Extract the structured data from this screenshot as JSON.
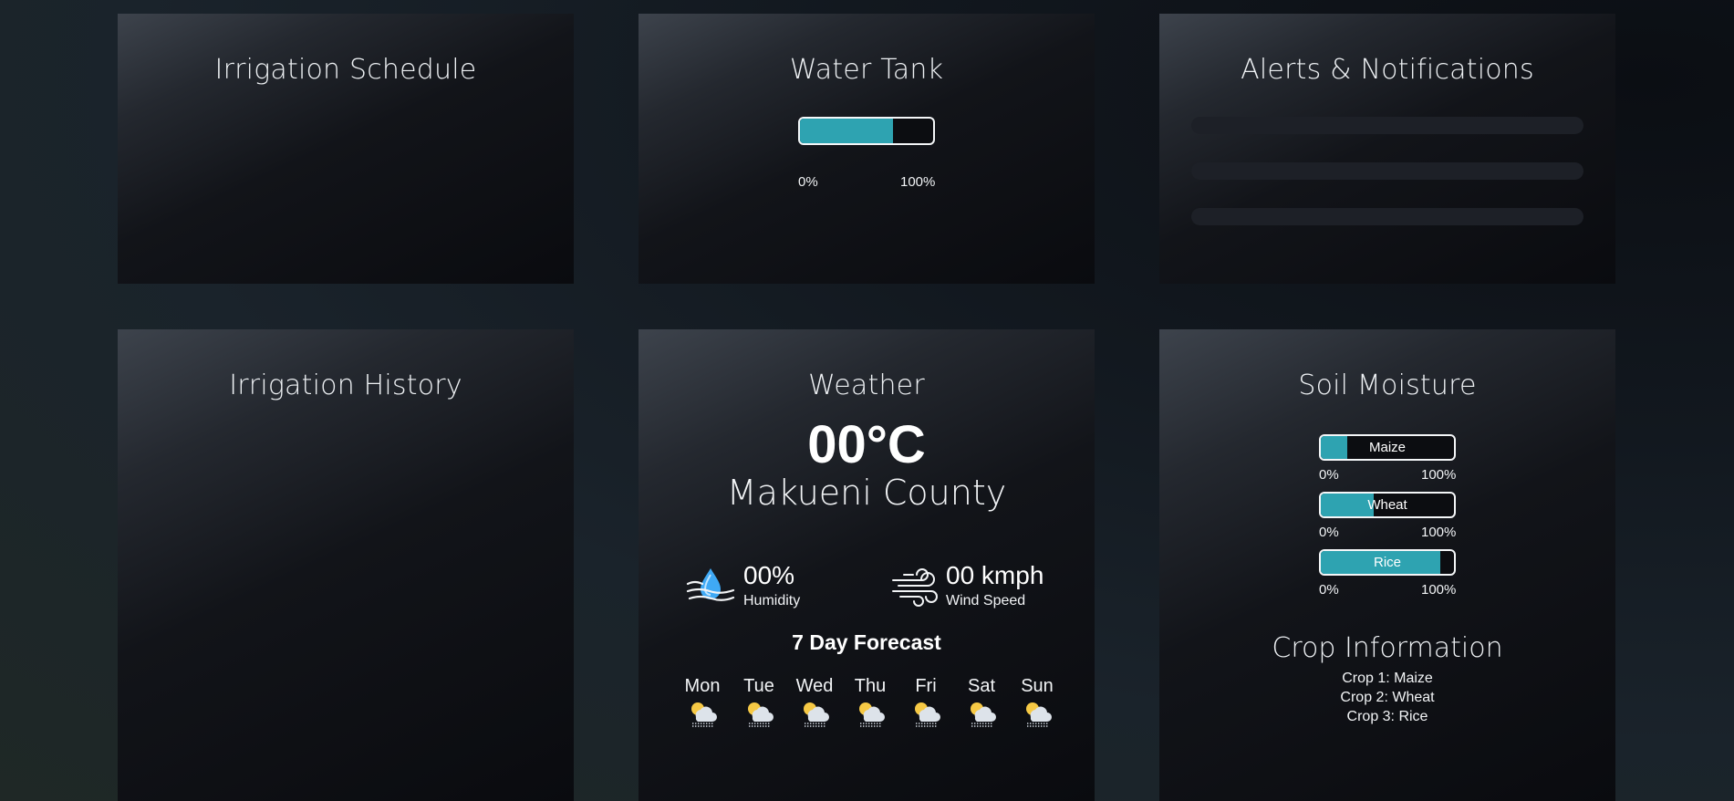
{
  "cards": {
    "irrigation_schedule": {
      "title": "Irrigation Schedule"
    },
    "water_tank": {
      "title": "Water Tank",
      "level_percent": 70,
      "scale_min": "0%",
      "scale_max": "100%"
    },
    "alerts": {
      "title": "Alerts & Notifications"
    },
    "irrigation_history": {
      "title": "Irrigation History"
    },
    "weather": {
      "title": "Weather",
      "temperature": "00°C",
      "location": "Makueni County",
      "humidity_value": "00%",
      "humidity_label": "Humidity",
      "wind_value": "00 kmph",
      "wind_label": "Wind Speed",
      "forecast_title": "7 Day Forecast",
      "forecast": [
        {
          "day": "Mon",
          "icon": "partly-cloudy-rain-icon"
        },
        {
          "day": "Tue",
          "icon": "partly-cloudy-rain-icon"
        },
        {
          "day": "Wed",
          "icon": "partly-cloudy-rain-icon"
        },
        {
          "day": "Thu",
          "icon": "partly-cloudy-rain-icon"
        },
        {
          "day": "Fri",
          "icon": "partly-cloudy-rain-icon"
        },
        {
          "day": "Sat",
          "icon": "partly-cloudy-rain-icon"
        },
        {
          "day": "Sun",
          "icon": "partly-cloudy-rain-icon"
        }
      ]
    },
    "soil_moisture": {
      "title": "Soil Moisture",
      "crops": [
        {
          "label": "Maize",
          "level_percent": 20,
          "min": "0%",
          "max": "100%"
        },
        {
          "label": "Wheat",
          "level_percent": 40,
          "min": "0%",
          "max": "100%"
        },
        {
          "label": "Rice",
          "level_percent": 90,
          "min": "0%",
          "max": "100%"
        }
      ],
      "crop_info_title": "Crop Information",
      "crop_info": [
        "Crop 1: Maize",
        "Crop 2: Wheat",
        "Crop 3: Rice"
      ]
    }
  },
  "colors": {
    "accent": "#2ea3b1",
    "bar_border": "#f4f6f8",
    "page_background": "#18212a"
  }
}
